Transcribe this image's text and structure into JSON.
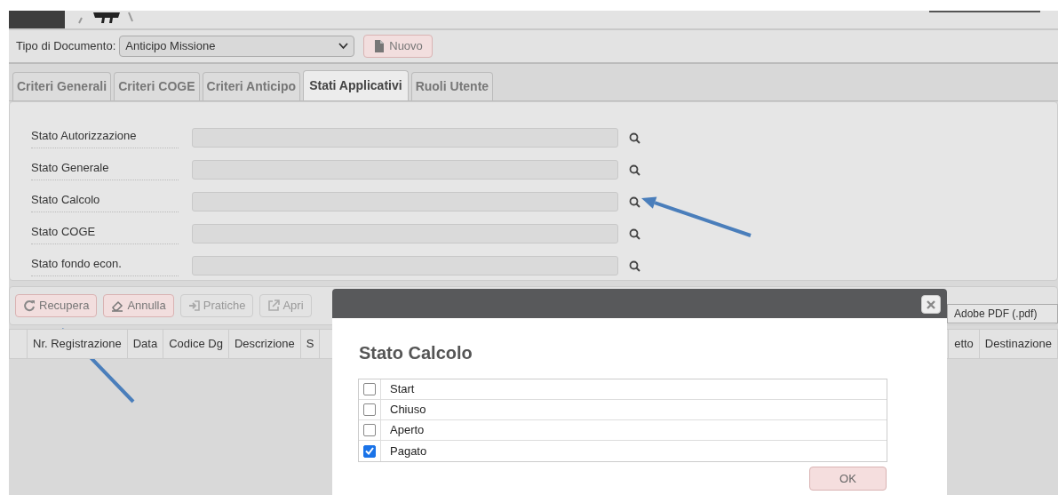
{
  "document_type": {
    "label": "Tipo di Documento:",
    "value": "Anticipo Missione"
  },
  "new_button": {
    "label": "Nuovo",
    "kind": "file"
  },
  "tabs": [
    {
      "label": "Criteri Generali",
      "selected": false
    },
    {
      "label": "Criteri COGE",
      "selected": false
    },
    {
      "label": "Criteri Anticipo",
      "selected": false
    },
    {
      "label": "Stati Applicativi",
      "selected": true
    },
    {
      "label": "Ruoli Utente",
      "selected": false
    }
  ],
  "fields": [
    {
      "label": "Stato Autorizzazione"
    },
    {
      "label": "Stato Generale"
    },
    {
      "label": "Stato Calcolo"
    },
    {
      "label": "Stato COGE"
    },
    {
      "label": "Stato fondo econ."
    }
  ],
  "toolbar": {
    "buttons": [
      {
        "label": "Recupera",
        "kind": "refresh",
        "disabled": false
      },
      {
        "label": "Annulla",
        "kind": "eraser",
        "disabled": false
      },
      {
        "label": "Pratiche",
        "kind": "login",
        "disabled": true
      },
      {
        "label": "Apri",
        "kind": "external",
        "disabled": true
      }
    ],
    "format": "Adobe PDF (.pdf)"
  },
  "table": {
    "columns_left": [
      "Nr. Registrazione",
      "Data",
      "Codice Dg",
      "Descrizione",
      "S"
    ],
    "columns_right": [
      "etto",
      "Destinazione"
    ]
  },
  "dialog": {
    "title": "Stato Calcolo",
    "options": [
      {
        "label": "Start",
        "checked": false
      },
      {
        "label": "Chiuso",
        "checked": false
      },
      {
        "label": "Aperto",
        "checked": false
      },
      {
        "label": "Pagato",
        "checked": true
      }
    ],
    "ok": "OK"
  }
}
